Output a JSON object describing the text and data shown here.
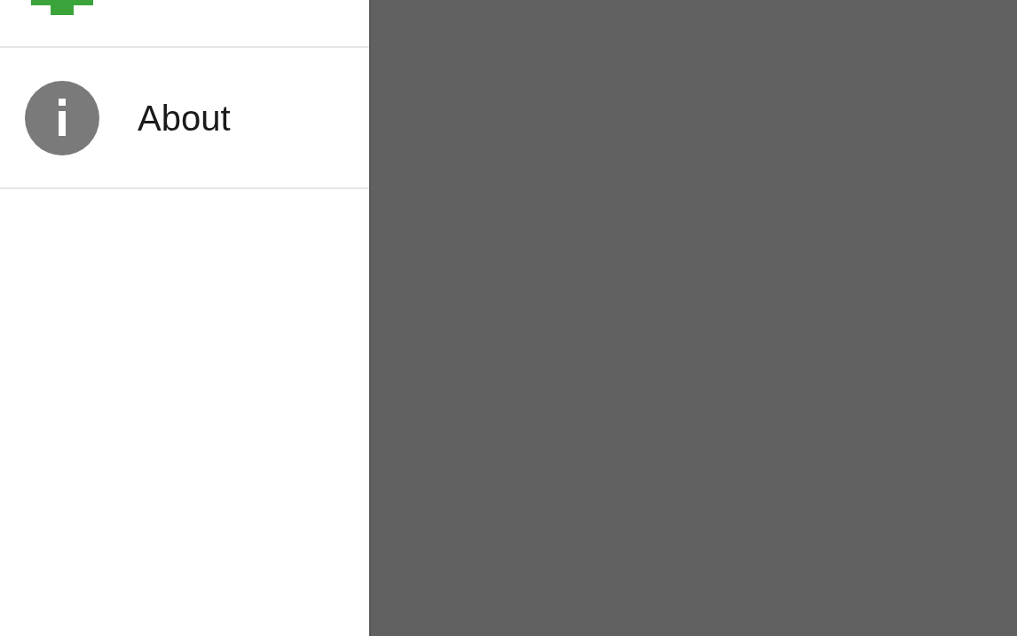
{
  "drawer": {
    "items": [
      {
        "label": "About"
      }
    ]
  }
}
